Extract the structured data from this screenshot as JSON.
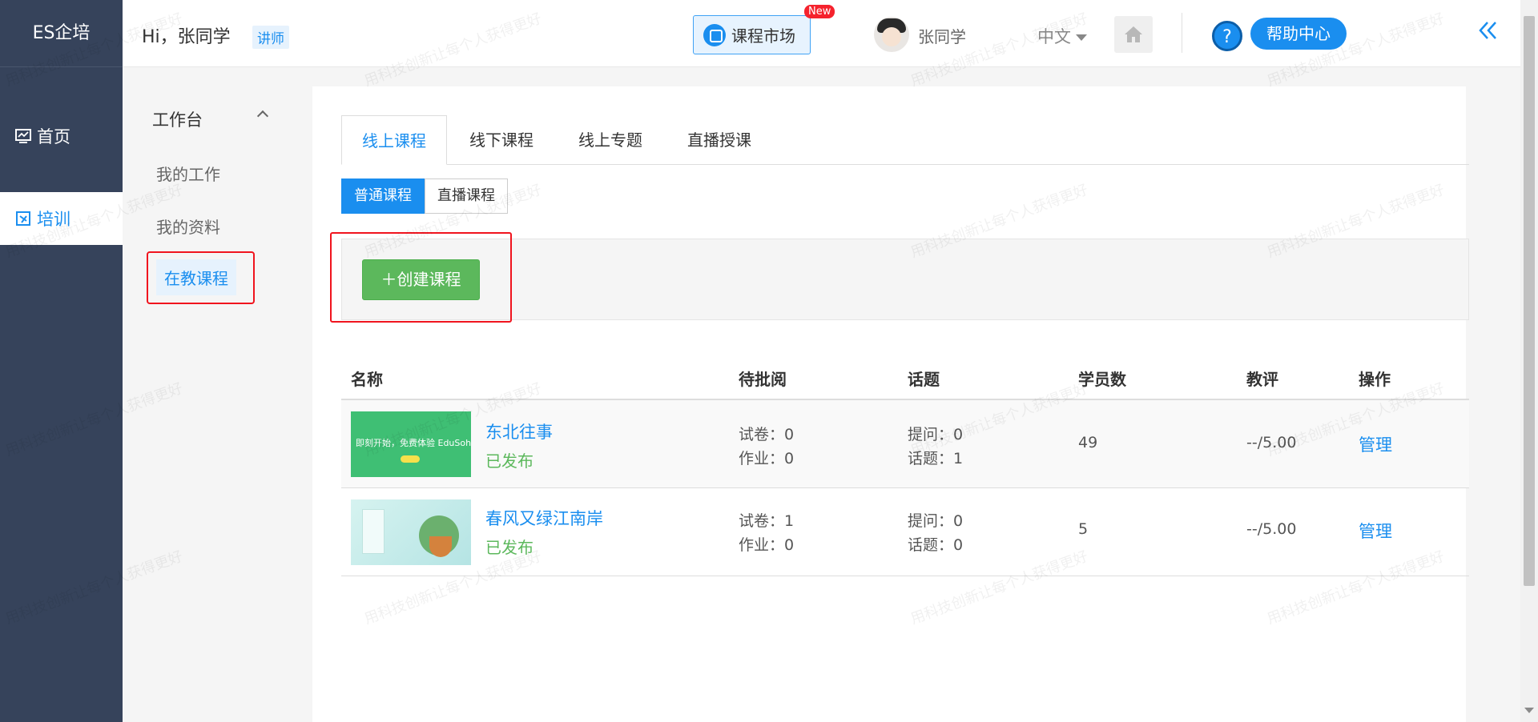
{
  "sidebar": {
    "brand": "ES企培",
    "items": [
      {
        "label": "首页",
        "icon": "chart-icon"
      },
      {
        "label": "培训",
        "icon": "book-icon"
      }
    ]
  },
  "header": {
    "greeting": "Hi，张同学",
    "role": "讲师",
    "market_label": "课程市场",
    "new_badge": "New",
    "user_name": "张同学",
    "language": "中文",
    "help_symbol": "?",
    "help_label": "帮助中心"
  },
  "subnav": {
    "title": "工作台",
    "items": [
      "我的工作",
      "我的资料",
      "在教课程"
    ]
  },
  "main": {
    "tabs": [
      "线上课程",
      "线下课程",
      "线上专题",
      "直播授课"
    ],
    "subtabs": [
      "普通课程",
      "直播课程"
    ],
    "create_label": "＋创建课程",
    "table": {
      "headers": [
        "名称",
        "待批阅",
        "话题",
        "学员数",
        "教评",
        "操作"
      ],
      "rows": [
        {
          "title": "东北往事",
          "status": "已发布",
          "thumb_text": "即刻开始，免费体验 EduSoho 强大功能",
          "exam": "试卷：0",
          "homework": "作业：0",
          "questions": "提问：0",
          "topics": "话题：1",
          "students": "49",
          "rating": "--/5.00",
          "action": "管理"
        },
        {
          "title": "春风又绿江南岸",
          "status": "已发布",
          "thumb_text": "",
          "exam": "试卷：1",
          "homework": "作业：0",
          "questions": "提问：0",
          "topics": "话题：0",
          "students": "5",
          "rating": "--/5.00",
          "action": "管理"
        }
      ]
    }
  },
  "watermark": "用科技创新让每个人获得更好",
  "colors": {
    "sidebar_bg": "#36435b",
    "accent": "#1a8eef",
    "success": "#5cb85c",
    "highlight_red": "#f0141e"
  }
}
